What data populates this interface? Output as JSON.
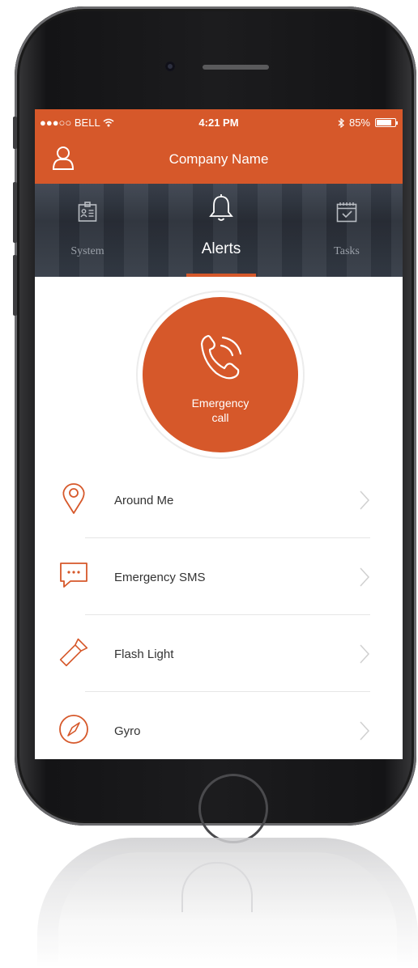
{
  "status_bar": {
    "carrier": "●●●○○ BELL",
    "time": "4:21 PM",
    "battery": "85%",
    "battery_level": 0.85
  },
  "header": {
    "title": "Company Name",
    "user_icon": "user-icon"
  },
  "tabs": [
    {
      "label": "System",
      "icon": "id-card-icon",
      "active": false
    },
    {
      "label": "Alerts",
      "icon": "bell-icon",
      "active": true
    },
    {
      "label": "Tasks",
      "icon": "calendar-check-icon",
      "active": false
    }
  ],
  "emergency_call": {
    "label_line1": "Emergency",
    "label_line2": "call",
    "icon": "phone-icon"
  },
  "menu": [
    {
      "label": "Around Me",
      "icon": "location-pin-icon"
    },
    {
      "label": "Emergency SMS",
      "icon": "message-icon"
    },
    {
      "label": "Flash Light",
      "icon": "flashlight-icon"
    },
    {
      "label": "Gyro",
      "icon": "compass-icon"
    }
  ],
  "colors": {
    "accent": "#d6582a",
    "tab_background": "#2f353f",
    "text": "#333333"
  }
}
